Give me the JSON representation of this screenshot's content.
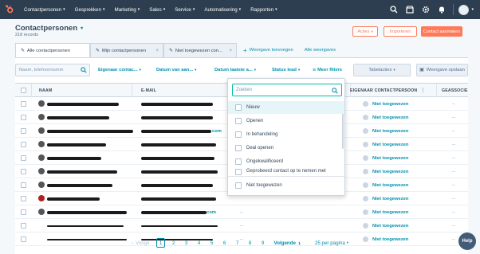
{
  "nav": {
    "items": [
      {
        "label": "Contactpersonen"
      },
      {
        "label": "Gesprekken"
      },
      {
        "label": "Marketing"
      },
      {
        "label": "Sales"
      },
      {
        "label": "Service"
      },
      {
        "label": "Automatisering"
      },
      {
        "label": "Rapporten"
      }
    ]
  },
  "header": {
    "title": "Contactpersonen",
    "record_count": "218 records",
    "actions_label": "Acties",
    "import_label": "Importeren",
    "create_label": "Contact aanmaken"
  },
  "tabs": {
    "items": [
      {
        "label": "Alle contactpersonen"
      },
      {
        "label": "Mijn contactpersonen"
      },
      {
        "label": "Niet toegewezen con..."
      }
    ],
    "add_view": "Weergave toevoegen",
    "all_views": "Alle weergaves"
  },
  "filters": {
    "search_placeholder": "Naam, telefoonnumm",
    "owner": "Eigenaar contac...",
    "created": "Datum van aan...",
    "last_activity": "Datum laatste a...",
    "lead_status": "Status lead",
    "more": "Meer filters",
    "table_actions": "Tabelacties",
    "save_view": "Weergave opslaan"
  },
  "table": {
    "columns": {
      "name": "NAAM",
      "email": "E-MAIL",
      "owner": "EIGENAAR CONTACTPERSOON",
      "assoc": "GEASSOCIE"
    },
    "rows": [
      {
        "email_suffix": "",
        "phone": "",
        "owner": "Niet toegewezen",
        "assoc": "--"
      },
      {
        "email_suffix": "",
        "phone": "",
        "owner": "Niet toegewezen",
        "assoc": "--"
      },
      {
        "email_suffix": "com",
        "phone": "",
        "owner": "Niet toegewezen",
        "assoc": "--"
      },
      {
        "email_suffix": "",
        "phone": "",
        "owner": "Niet toegewezen",
        "assoc": "--"
      },
      {
        "email_suffix": "",
        "phone": "",
        "owner": "Niet toegewezen",
        "assoc": "--"
      },
      {
        "email_suffix": "",
        "phone": "",
        "owner": "Niet toegewezen",
        "assoc": "--"
      },
      {
        "email_suffix": "",
        "phone": "",
        "owner": "Niet toegewezen",
        "assoc": "--"
      },
      {
        "email_suffix": "",
        "phone": "",
        "owner": "Niet toegewezen",
        "assoc": "--"
      },
      {
        "email_suffix": "com",
        "phone": "--",
        "owner": "Niet toegewezen",
        "assoc": "--"
      },
      {
        "email_suffix": "",
        "phone": "--",
        "owner": "Niet toegewezen",
        "assoc": "--"
      },
      {
        "email_suffix": "",
        "phone": "--",
        "owner": "Niet toegewezen",
        "assoc": "--"
      }
    ]
  },
  "lead_status_dropdown": {
    "search_placeholder": "Zoeken",
    "options": [
      {
        "label": "Nieuw"
      },
      {
        "label": "Openen"
      },
      {
        "label": "In behandeling"
      },
      {
        "label": "Deal openen"
      },
      {
        "label": "Ongekwalificeerd"
      },
      {
        "label": "Geprobeerd contact op te nemen met"
      }
    ],
    "unassigned": "Niet toegewezen"
  },
  "pagination": {
    "prev": "Vorige",
    "pages": [
      "1",
      "2",
      "3",
      "4",
      "5",
      "6",
      "7",
      "8",
      "9"
    ],
    "next": "Volgende",
    "page_size": "25 per pagina"
  },
  "help_label": "Help",
  "colors": {
    "nav_bg": "#2d3e50",
    "accent_orange": "#ff7a59",
    "link_teal": "#0091ae",
    "focus_green": "#00bda5"
  }
}
